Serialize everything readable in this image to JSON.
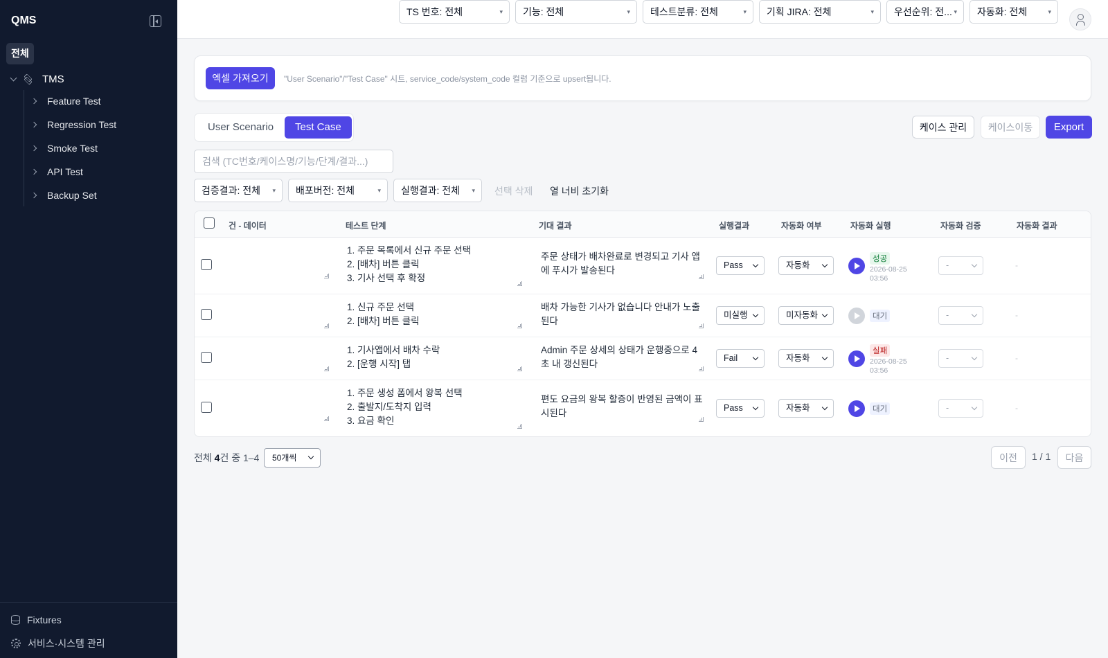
{
  "sidebar": {
    "brand": "QMS",
    "all_label": "전체",
    "root": {
      "label": "TMS"
    },
    "items": [
      {
        "label": "Feature Test"
      },
      {
        "label": "Regression Test"
      },
      {
        "label": "Smoke Test"
      },
      {
        "label": "API Test"
      },
      {
        "label": "Backup Set"
      }
    ],
    "footer": [
      {
        "label": "Fixtures",
        "icon": "database-icon"
      },
      {
        "label": "서비스·시스템 관리",
        "icon": "gear-icon"
      }
    ]
  },
  "import": {
    "button_label": "엑셀 가져오기",
    "note": "\"User Scenario\"/\"Test Case\" 시트, service_code/system_code 컬럼 기준으로 upsert됩니다."
  },
  "tabs": [
    {
      "label": "User Scenario",
      "active": false
    },
    {
      "label": "Test Case",
      "active": true
    }
  ],
  "actions": {
    "case_manage": "케이스 관리",
    "case_move": "케이스이동",
    "export": "Export"
  },
  "filters": {
    "search_placeholder": "검색 (TC번호/케이스명/기능/단계/결과...)",
    "ts_number": "TS 번호: 전체",
    "feature": "기능: 전체",
    "test_category": "테스트분류: 전체",
    "plan_jira": "기획 JIRA: 전체",
    "priority": "우선순위: 전...",
    "automation": "자동화: 전체",
    "verify_result": "검증결과: 전체",
    "release_version": "배포버전: 전체",
    "exec_result": "실행결과: 전체",
    "delete_selected": "선택 삭제",
    "reset_width": "열 너비 초기화"
  },
  "table": {
    "headers": {
      "data": "건 - 데이터",
      "steps": "테스트 단계",
      "expected": "기대 결과",
      "exec_result": "실행결과",
      "automation": "자동화 여부",
      "auto_run": "자동화 실행",
      "auto_verify": "자동화 검증",
      "auto_result": "자동화 결과"
    },
    "rows": [
      {
        "steps": "1. 주문 목록에서 신규 주문 선택\n2. [배차] 버튼 클릭\n3. 기사 선택 후 확정",
        "expected": "주문 상태가 배차완료로 변경되고 기사 앱\n에 푸시가 발송된다",
        "exec_result": "Pass",
        "automation": "자동화",
        "run_status": "성공",
        "run_time": "2026-08-25 03:56",
        "auto_verify": "-",
        "auto_result": "-"
      },
      {
        "steps": "1. 신규 주문 선택\n2. [배차] 버튼 클릭",
        "expected": "배차 가능한 기사가 없습니다 안내가 노출\n된다",
        "exec_result": "미실행",
        "automation": "미자동화",
        "run_status": "대기",
        "run_time": "",
        "auto_verify": "-",
        "auto_result": "-"
      },
      {
        "steps": "1. 기사앱에서 배차 수락\n2. [운행 시작] 탭",
        "expected": "Admin 주문 상세의 상태가 운행중으로 4\n초 내 갱신된다",
        "exec_result": "Fail",
        "automation": "자동화",
        "run_status": "실패",
        "run_time": "2026-08-25 03:56",
        "auto_verify": "-",
        "auto_result": "-"
      },
      {
        "steps": "1. 주문 생성 폼에서 왕복 선택\n2. 출발지/도착지 입력\n3. 요금 확인",
        "expected": "편도 요금의 왕복 할증이 반영된 금액이 표\n시된다",
        "exec_result": "Pass",
        "automation": "자동화",
        "run_status": "대기",
        "run_time": "",
        "auto_verify": "-",
        "auto_result": "-"
      }
    ]
  },
  "pager": {
    "total_prefix": "전체 ",
    "total_count": "4",
    "total_suffix": "건 중 1–4",
    "page_size": "50개씩",
    "prev": "이전",
    "page_info": "1 / 1",
    "next": "다음"
  },
  "colors": {
    "accent": "#4f46e5",
    "sidebar_bg": "#111a2e",
    "success": "#15803d",
    "fail": "#b91c1c"
  }
}
